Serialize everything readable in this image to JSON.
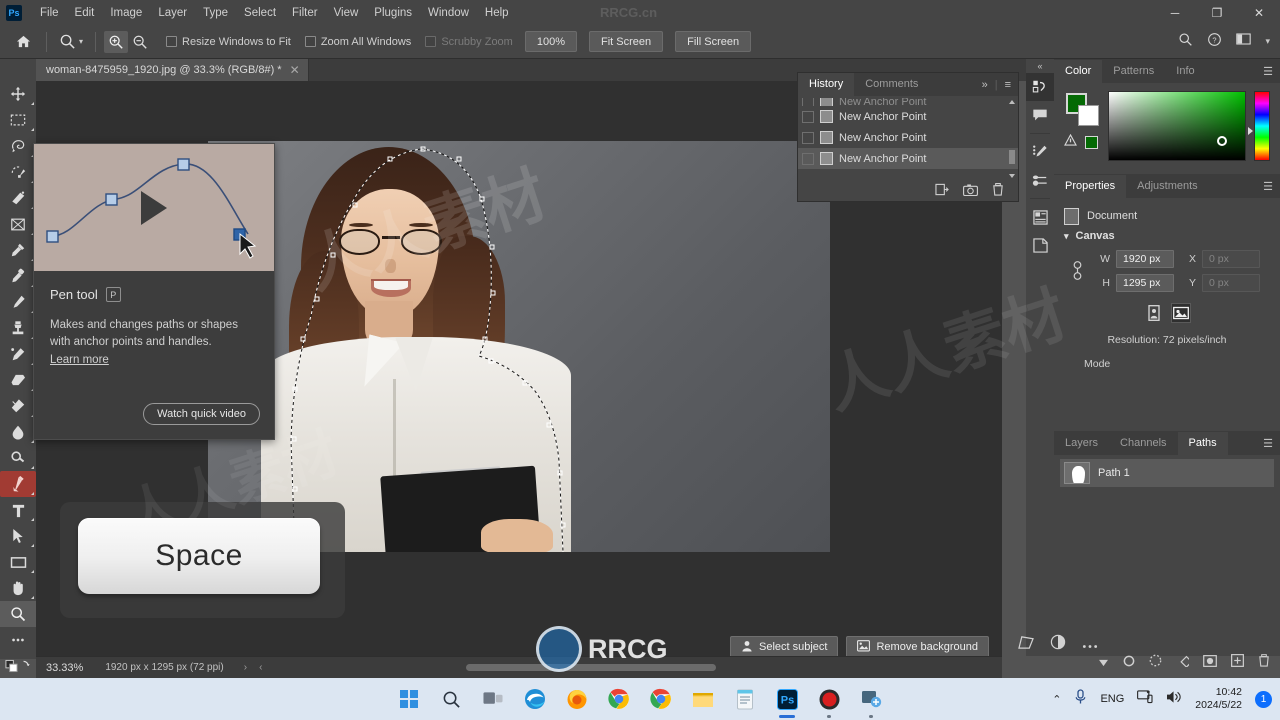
{
  "app": {
    "logo": "Ps",
    "menus": [
      "File",
      "Edit",
      "Image",
      "Layer",
      "Type",
      "Select",
      "Filter",
      "View",
      "Plugins",
      "Window",
      "Help"
    ],
    "window_controls": {
      "minimize": "─",
      "restore": "❐",
      "close": "✕"
    },
    "top_watermark": "RRCG.cn"
  },
  "options_bar": {
    "home_icon": "home-icon",
    "tool_icon": "zoom-tool-icon",
    "zoom_in_icon": "zoom-in-icon",
    "zoom_out_icon": "zoom-out-icon",
    "checkboxes": [
      {
        "label": "Resize Windows to Fit",
        "checked": false,
        "disabled": false
      },
      {
        "label": "Zoom All Windows",
        "checked": false,
        "disabled": false
      },
      {
        "label": "Scrubby Zoom",
        "checked": false,
        "disabled": true
      }
    ],
    "buttons": [
      "100%",
      "Fit Screen",
      "Fill Screen"
    ],
    "right_icons": [
      "search-icon",
      "help-icon",
      "workspace-icon",
      "chevron-down-icon"
    ]
  },
  "document": {
    "tab_title": "woman-8475959_1920.jpg @ 33.3% (RGB/8#) *",
    "close_glyph": "✕",
    "collapse_glyph": "»"
  },
  "toolbar": {
    "tools": [
      {
        "name": "move-tool",
        "glyph": "move"
      },
      {
        "name": "rectangular-marquee-tool",
        "glyph": "marquee"
      },
      {
        "name": "lasso-tool",
        "glyph": "lasso"
      },
      {
        "name": "object-selection-tool",
        "glyph": "objsel"
      },
      {
        "name": "quick-selection-tool",
        "glyph": "quicksel"
      },
      {
        "name": "crop-tool",
        "glyph": "crop"
      },
      {
        "name": "eyedropper-tool",
        "glyph": "eyedropper"
      },
      {
        "name": "spot-healing-brush-tool",
        "glyph": "healing"
      },
      {
        "name": "brush-tool",
        "glyph": "brush"
      },
      {
        "name": "clone-stamp-tool",
        "glyph": "stamp"
      },
      {
        "name": "history-brush-tool",
        "glyph": "historybrush"
      },
      {
        "name": "eraser-tool",
        "glyph": "eraser"
      },
      {
        "name": "gradient-tool",
        "glyph": "gradient"
      },
      {
        "name": "blur-tool",
        "glyph": "blur"
      },
      {
        "name": "dodge-tool",
        "glyph": "dodge"
      },
      {
        "name": "pen-tool",
        "glyph": "pen",
        "active": true
      },
      {
        "name": "type-tool",
        "glyph": "type"
      },
      {
        "name": "path-selection-tool",
        "glyph": "pathsel"
      },
      {
        "name": "rectangle-tool",
        "glyph": "rect"
      },
      {
        "name": "hand-tool",
        "glyph": "hand"
      },
      {
        "name": "zoom-tool",
        "glyph": "zoom",
        "selected": true
      },
      {
        "name": "edit-toolbar-button",
        "glyph": "dots"
      }
    ],
    "foreground_color": "#046a04",
    "background_color": "#ffffff"
  },
  "tooltip_card": {
    "title": "Pen tool",
    "shortcut": "P",
    "description": "Makes and changes paths or shapes with anchor points and handles.",
    "learn_more": "Learn more",
    "watch_button": "Watch quick video"
  },
  "key_overlay": {
    "label": "Space"
  },
  "history_panel": {
    "tabs": [
      {
        "label": "History",
        "active": true
      },
      {
        "label": "Comments",
        "active": false
      }
    ],
    "menu_glyphs": [
      "»",
      "≡"
    ],
    "items": [
      {
        "label": "New Anchor Point",
        "faded": true,
        "selected": false
      },
      {
        "label": "New Anchor Point",
        "faded": false,
        "selected": false
      },
      {
        "label": "New Anchor Point",
        "faded": false,
        "selected": false
      },
      {
        "label": "New Anchor Point",
        "faded": false,
        "selected": true
      }
    ],
    "footer_icons": [
      "new-document-from-state-icon",
      "new-snapshot-icon",
      "delete-icon"
    ]
  },
  "dock_rail": {
    "collapse_glyph": "«",
    "items": [
      {
        "name": "history-rail-icon",
        "selected": true
      },
      {
        "name": "comments-rail-icon",
        "selected": false
      },
      {
        "name": "brush-settings-rail-icon",
        "selected": false
      },
      {
        "name": "brushes-rail-icon",
        "selected": false
      },
      {
        "name": "properties-rail-icon",
        "selected": false
      },
      {
        "name": "layers-comp-rail-icon",
        "selected": false
      }
    ]
  },
  "color_panel": {
    "tabs": [
      {
        "label": "Color",
        "active": true
      },
      {
        "label": "Patterns",
        "active": false
      },
      {
        "label": "Info",
        "active": false
      }
    ],
    "foreground": "#046a04",
    "background": "#ffffff",
    "warning_icon": "gamut-warning-icon",
    "proof_swatch": "#046a04"
  },
  "properties_panel": {
    "tabs": [
      {
        "label": "Properties",
        "active": true
      },
      {
        "label": "Adjustments",
        "active": false
      }
    ],
    "doc_row_label": "Document",
    "section_canvas": "Canvas",
    "fields": {
      "w_label": "W",
      "w_value": "1920 px",
      "h_label": "H",
      "h_value": "1295 px",
      "x_label": "X",
      "x_value": "0 px",
      "y_label": "Y",
      "y_value": "0 px"
    },
    "orientation": [
      {
        "name": "portrait-orientation-button",
        "selected": false
      },
      {
        "name": "landscape-orientation-button",
        "selected": true
      }
    ],
    "resolution": "Resolution: 72 pixels/inch",
    "mode_label": "Mode"
  },
  "layers_panel": {
    "tabs": [
      {
        "label": "Layers",
        "active": false
      },
      {
        "label": "Channels",
        "active": false
      },
      {
        "label": "Paths",
        "active": true
      }
    ],
    "paths": [
      {
        "name": "Path 1",
        "selected": true
      }
    ],
    "footer_icons": [
      "fill-path-icon",
      "stroke-path-icon",
      "load-selection-icon",
      "make-work-path-icon",
      "add-mask-icon",
      "new-path-icon",
      "delete-path-icon"
    ]
  },
  "status_bar": {
    "zoom": "33.33%",
    "doc_dimensions": "1920 px x 1295 px (72 ppi)",
    "nav_glyphs": [
      "›",
      "‹"
    ]
  },
  "ai_bar": {
    "select_subject": "Select subject",
    "remove_background": "Remove background",
    "extra_icons": [
      "transform-icon",
      "adjustment-icon",
      "more-options-icon"
    ]
  },
  "taskbar": {
    "items": [
      {
        "name": "start-button"
      },
      {
        "name": "search-icon"
      },
      {
        "name": "task-view-icon"
      },
      {
        "name": "edge-icon"
      },
      {
        "name": "firefox-icon"
      },
      {
        "name": "chrome-icon"
      },
      {
        "name": "chrome-beta-icon"
      },
      {
        "name": "file-explorer-icon"
      },
      {
        "name": "notepad-icon"
      },
      {
        "name": "photoshop-icon",
        "active": true
      },
      {
        "name": "recorder-icon"
      },
      {
        "name": "snipping-tool-icon"
      }
    ],
    "tray": {
      "chevron": "⌃",
      "mic_icon": "microphone-icon",
      "language": "ENG",
      "network_icon": "network-icon",
      "volume_icon": "volume-icon",
      "time": "10:42",
      "date": "2024/5/22",
      "notification_count": "1"
    }
  },
  "watermarks": {
    "brand": "RRCG",
    "site": "RRCG.cn"
  }
}
